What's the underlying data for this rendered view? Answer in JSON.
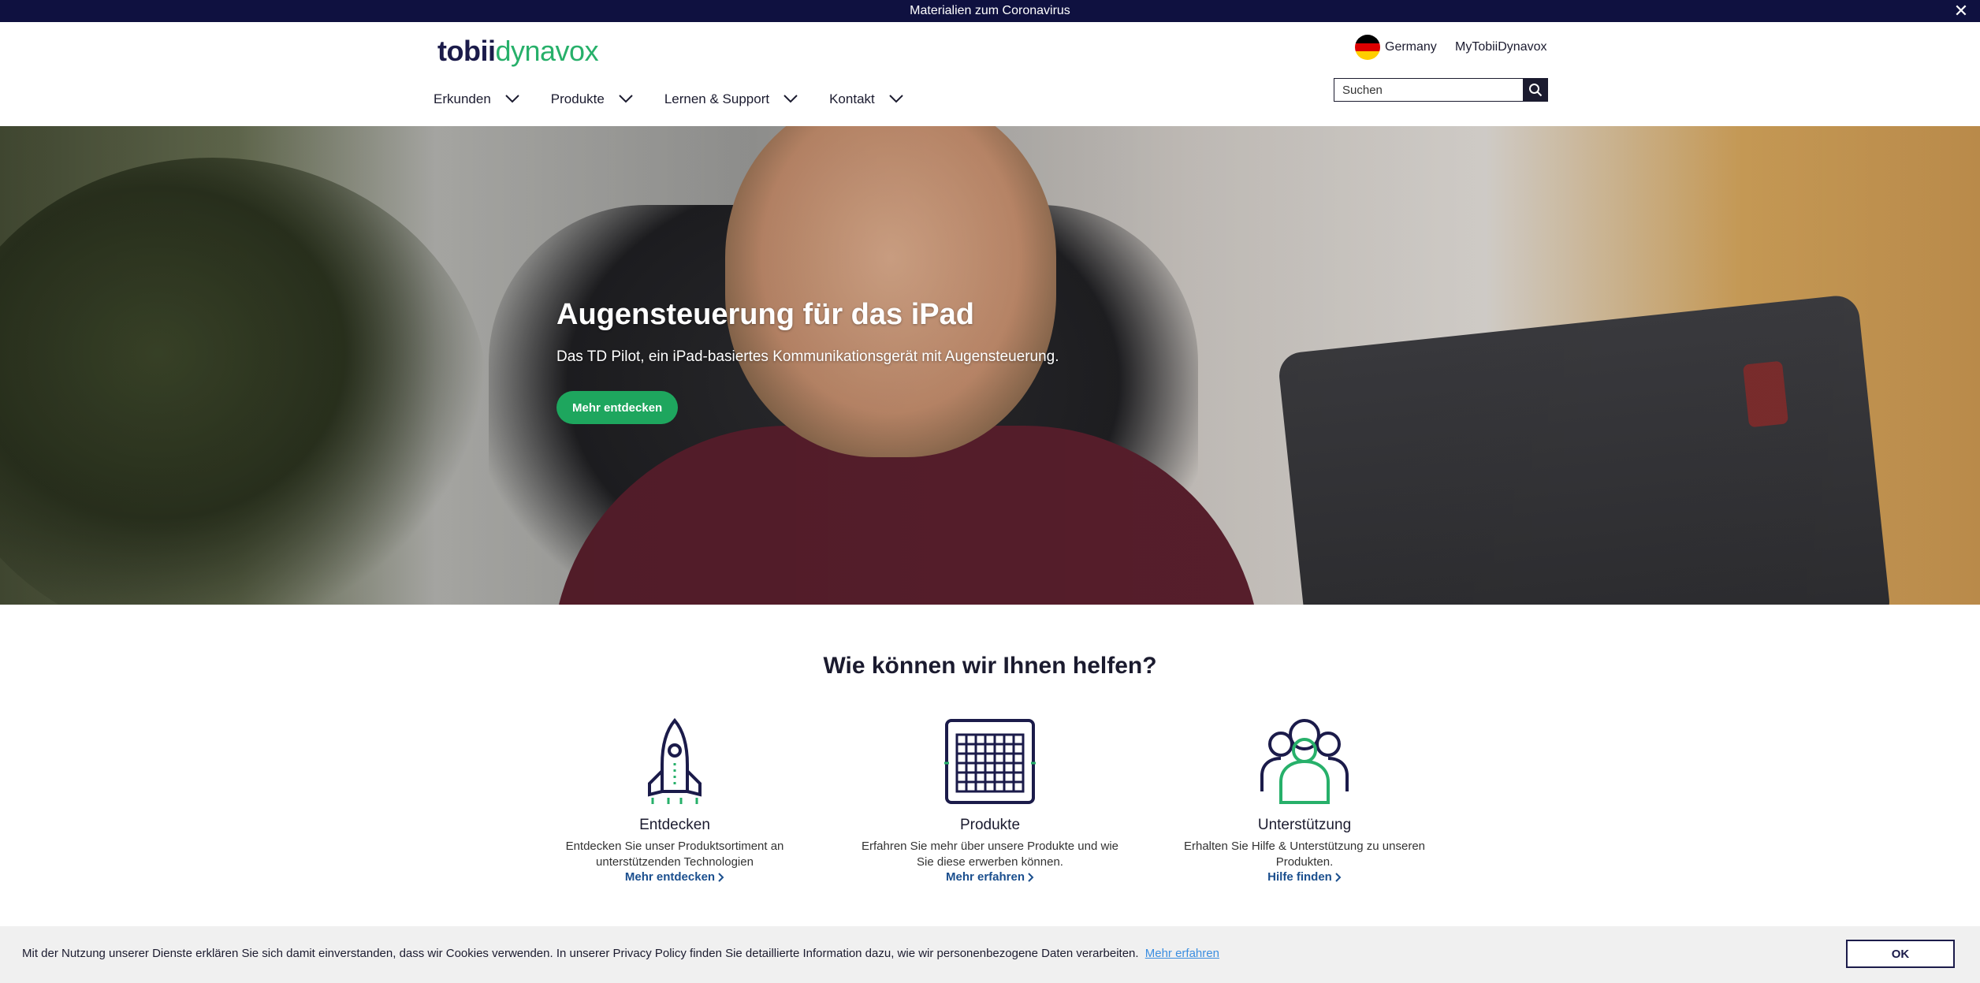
{
  "announcement": {
    "text": "Materialien zum Coronavirus",
    "close": "✕"
  },
  "header": {
    "logo": {
      "part1": "tobii",
      "part2": "dynavox"
    },
    "country": "Germany",
    "account_link": "MyTobiiDynavox",
    "nav": [
      "Erkunden",
      "Produkte",
      "Lernen & Support",
      "Kontakt"
    ],
    "search": {
      "placeholder": "Suchen",
      "value": "Suchen"
    }
  },
  "hero": {
    "title": "Augensteuerung für das iPad",
    "subtitle": "Das TD Pilot, ein iPad-basiertes Kommunikationsgerät mit Augensteuerung.",
    "button": "Mehr entdecken"
  },
  "help": {
    "title": "Wie können wir Ihnen helfen?",
    "cards": [
      {
        "icon": "rocket-icon",
        "title": "Entdecken",
        "description": "Entdecken Sie unser Produktsortiment an unterstützenden Technologien",
        "link": "Mehr entdecken"
      },
      {
        "icon": "grid-device-icon",
        "title": "Produkte",
        "description": "Erfahren Sie mehr über unsere Produkte und wie Sie diese erwerben können.",
        "link": "Mehr erfahren"
      },
      {
        "icon": "people-group-icon",
        "title": "Unterstützung",
        "description": "Erhalten Sie Hilfe & Unterstützung zu unseren Produkten.",
        "link": "Hilfe finden"
      }
    ]
  },
  "cookie": {
    "text": "Mit der Nutzung unserer Dienste erklären Sie sich damit einverstanden, dass wir Cookies verwenden. In unserer Privacy Policy finden Sie detaillierte Information dazu, wie wir personenbezogene Daten verarbeiten.",
    "link": "Mehr erfahren",
    "button": "OK"
  },
  "colors": {
    "navy": "#0f1140",
    "brand_green": "#27b06a",
    "button_green": "#1ea65e",
    "link_blue": "#1b4f8e"
  }
}
